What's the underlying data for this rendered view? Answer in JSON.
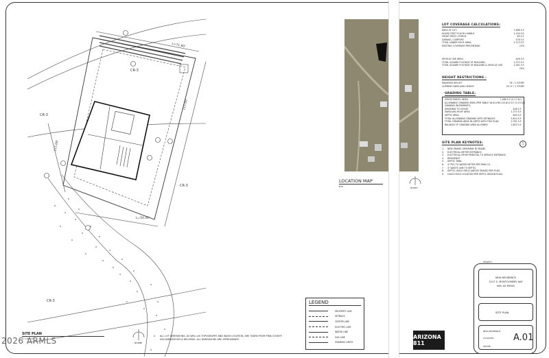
{
  "watermark": "2026 ARMLS",
  "site_plan": {
    "labels": {
      "cr3_top": "CR-3",
      "cr3_left": "CR-3",
      "cr3_right": "CR-3",
      "cr3_bottom": "CR-3",
      "dim_top": "L=71.60'",
      "dim_bottom": "L=50.41'",
      "dim_left": "115.00'",
      "dim_right": "115.00'"
    },
    "title": "SITE PLAN",
    "scale": "1\"=20'-0\"",
    "north_label": "NORTH",
    "note": "ALL LOT DIMENSIONS, AS WELL AS TOPOGRAPHY AND WASH LOCATION, ARE TAKEN FROM PIMA COUNTY DOCUMENTATION & RECORDS. ALL DIMENSIONS ARE APPROXIMATE."
  },
  "legend": {
    "title": "LEGEND",
    "items": [
      "PROPERTY LINE",
      "SETBACK",
      "CENTER LINE",
      "ELECTRIC LINE",
      "WATER LINE",
      "GAS LINE",
      "GRADING LIMITS"
    ]
  },
  "location_map": {
    "title": "LOCATION MAP",
    "scale": "NTS",
    "north_label": "NORTH"
  },
  "lot_coverage": {
    "title": "LOT COVERAGE CALCULATIONS:",
    "rows": [
      [
        "AREA OF LOT:",
        "7,486 S.F."
      ],
      [
        "HOUSE FIRST FLOOR LIVABLE:",
        "1,150 S.F."
      ],
      [
        "FRONT PATIO / PORCH:",
        "85 S.F."
      ],
      [
        "GARAGE / CARPORT:",
        "478 S.F."
      ],
      [
        "TOTAL UNDER ROOF AREA:",
        "1,713 S.F."
      ],
      [
        "EXISTING COVERAGE PERCENTAGE:",
        "23%"
      ]
    ],
    "rows2": [
      [
        "VEHICLE USE AREA:",
        "448 S.F."
      ],
      [
        "TOTAL SQUARE FOOTAGE OF BUILDING:",
        "1,713 S.F."
      ],
      [
        "TOTAL SQUARE FOOTAGE OF BUILDING & VEHICLE USE:",
        "2,161 S.F."
      ],
      [
        "",
        "29%"
      ]
    ]
  },
  "height_restrictions": {
    "title": "HEIGHT RESTRICTIONS :",
    "rows": [
      [
        "MAXIMUM HEIGHT:",
        "34' / 2 STORY"
      ],
      [
        "CURRENT DWELLING HEIGHT:",
        "20'-0\" / 1 STORY"
      ]
    ]
  },
  "grading_table": {
    "title": "GRADING TABLE:",
    "rows": [
      [
        "GROSS PARCEL AREA",
        "7,486 S.F. (0.17 AC)"
      ],
      [
        "ALLOWABLE GRADING AREA (PER TABLE 18.61.090-1)",
        "5,614 S.F. (0.13 AC)"
      ],
      [
        "GRADING INCREMENTS:",
        ""
      ],
      [
        "DRIVEWAY TO HOUSE",
        "448 S.F."
      ],
      [
        "DWELLING ROOF AREA",
        "1,713 S.F."
      ],
      [
        "SEPTIC AREA",
        "600 S.F."
      ],
      [
        "TOTAL ALLOWABLE GRADING WITH SETBACKS",
        "5,614 S.F."
      ],
      [
        "TOTAL GRADING AREA IN LIMITS WITH THIS PLAN",
        "2,761 S.F."
      ],
      [
        "BALANCE OF GRADING AREA ALLOWED",
        "2,853 S.F."
      ]
    ]
  },
  "keynotes": {
    "title": "SITE PLAN KEYNOTES:",
    "badge": "1",
    "items": [
      "NEW GRAVEL DRIVEWAY @ GRADE.",
      "ELECTRICAL METER ENTRANCE.",
      "ELECTRICAL FROM PEDESTAL TO SERVICE ENTRANCE.",
      "RESIDENCE.",
      "SEPTIC TANK.",
      "4\" PVC TO WATER METER PER PIMA CO.",
      "4\" WASTE LINE TO SEPTIC.",
      "SEPTIC LEACH FIELD (ABOVE GRADE) PER PLAN.",
      "LEACH FIELD LOCATION PER SEPTIC DESIGN PLAN."
    ]
  },
  "title_block": {
    "project_label": "PROJECT",
    "project_name": "NEW RESIDENCE",
    "address_line1": "1017 S. MONTGOMERY AVE",
    "address_line2": "VAIL AZ 85641",
    "sheet_title": "SITE PLAN",
    "job_label": "NEW RESIDENCE",
    "date": "2/24/2026",
    "drawn": "WAYNE",
    "sheet_number": "A.01"
  },
  "logo": {
    "text": "ARIZONA 811"
  },
  "colors": {
    "line": "#333333",
    "map_ground": "#8e8871",
    "roof_dark": "#111111"
  }
}
